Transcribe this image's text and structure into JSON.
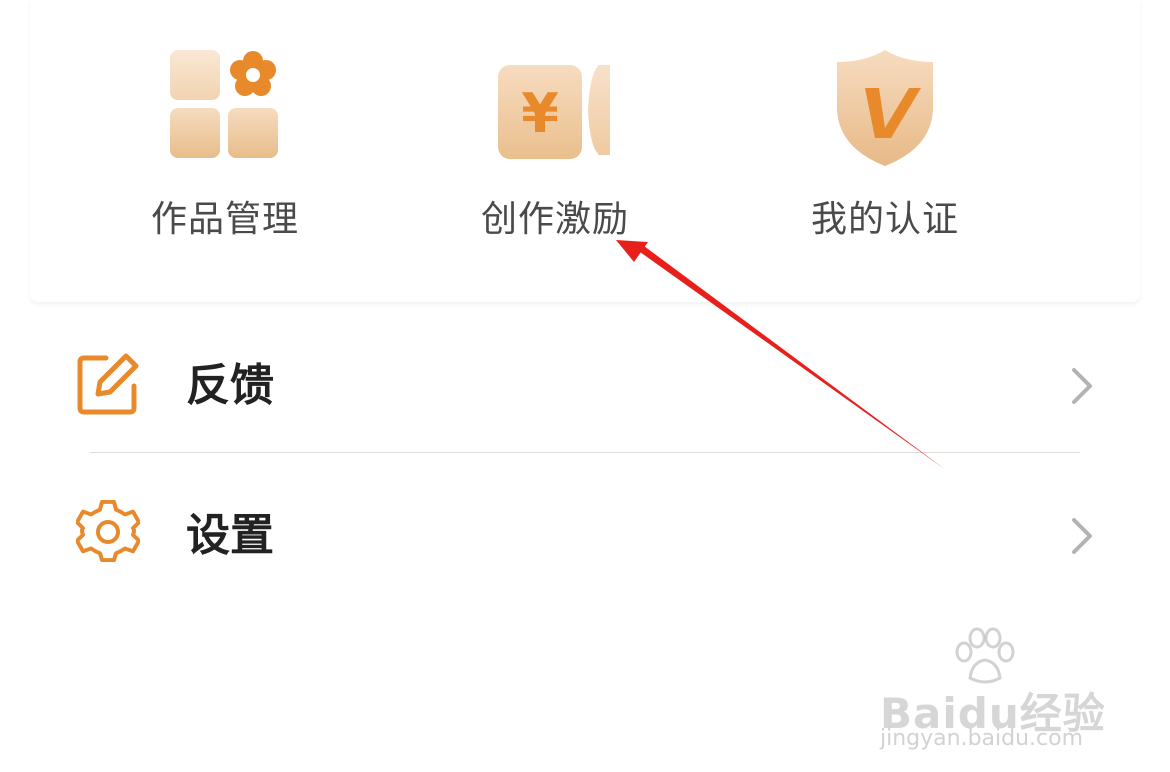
{
  "grid": {
    "items": [
      {
        "label": "作品管理",
        "icon": "works-grid-icon"
      },
      {
        "label": "创作激励",
        "icon": "yuan-coin-icon"
      },
      {
        "label": "我的认证",
        "icon": "verified-shield-icon"
      }
    ]
  },
  "list": {
    "items": [
      {
        "label": "反馈",
        "icon": "edit-icon"
      },
      {
        "label": "设置",
        "icon": "gear-icon"
      }
    ]
  },
  "annotation": {
    "arrow_color": "#e8201c"
  },
  "watermark": {
    "logo": "Baidu经验",
    "url": "jingyan.baidu.com"
  },
  "colors": {
    "accent": "#e8892b",
    "icon_light": "#f4d6b4",
    "icon_mid": "#e9bf8e",
    "chevron": "#b3b3b3"
  }
}
